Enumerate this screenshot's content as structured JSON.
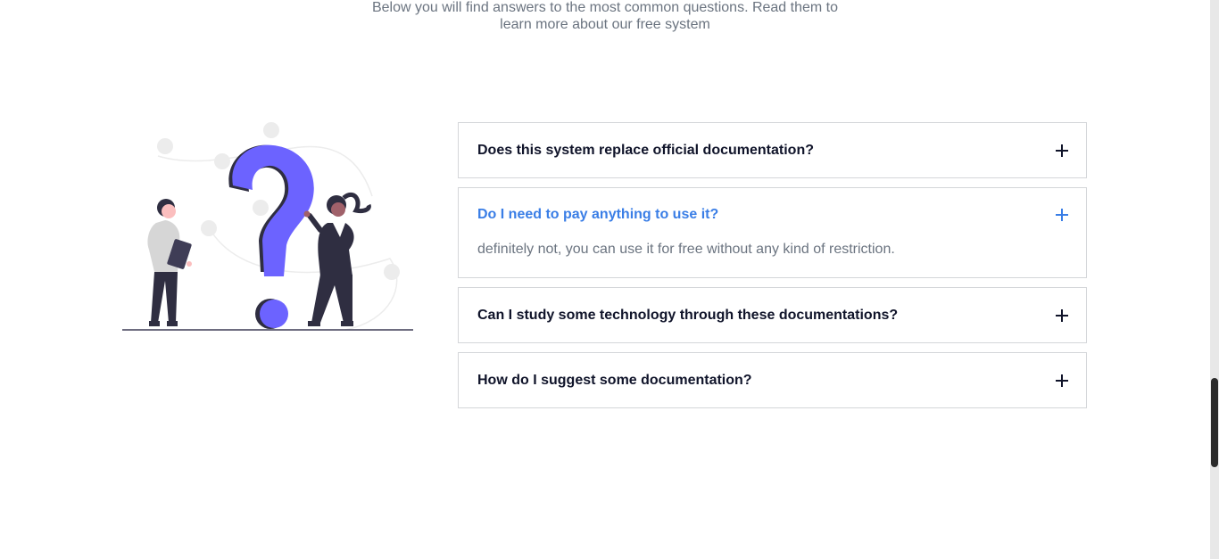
{
  "intro": {
    "line1": "Below you will find answers to the most common questions. Read them to",
    "line2": "learn more about our free system"
  },
  "illustration": {
    "icon": "question-mark-people-illustration",
    "accent_color": "#6c63ff"
  },
  "faq": {
    "items": [
      {
        "question": "Does this system replace official documentation?",
        "open": false
      },
      {
        "question": "Do I need to pay anything to use it?",
        "answer": "definitely not, you can use it for free without any kind of restriction.",
        "open": true
      },
      {
        "question": "Can I study some technology through these documentations?",
        "open": false
      },
      {
        "question": "How do I suggest some documentation?",
        "open": false
      }
    ],
    "toggle_icon": "plus-icon",
    "active_color": "#3a7ee6"
  }
}
